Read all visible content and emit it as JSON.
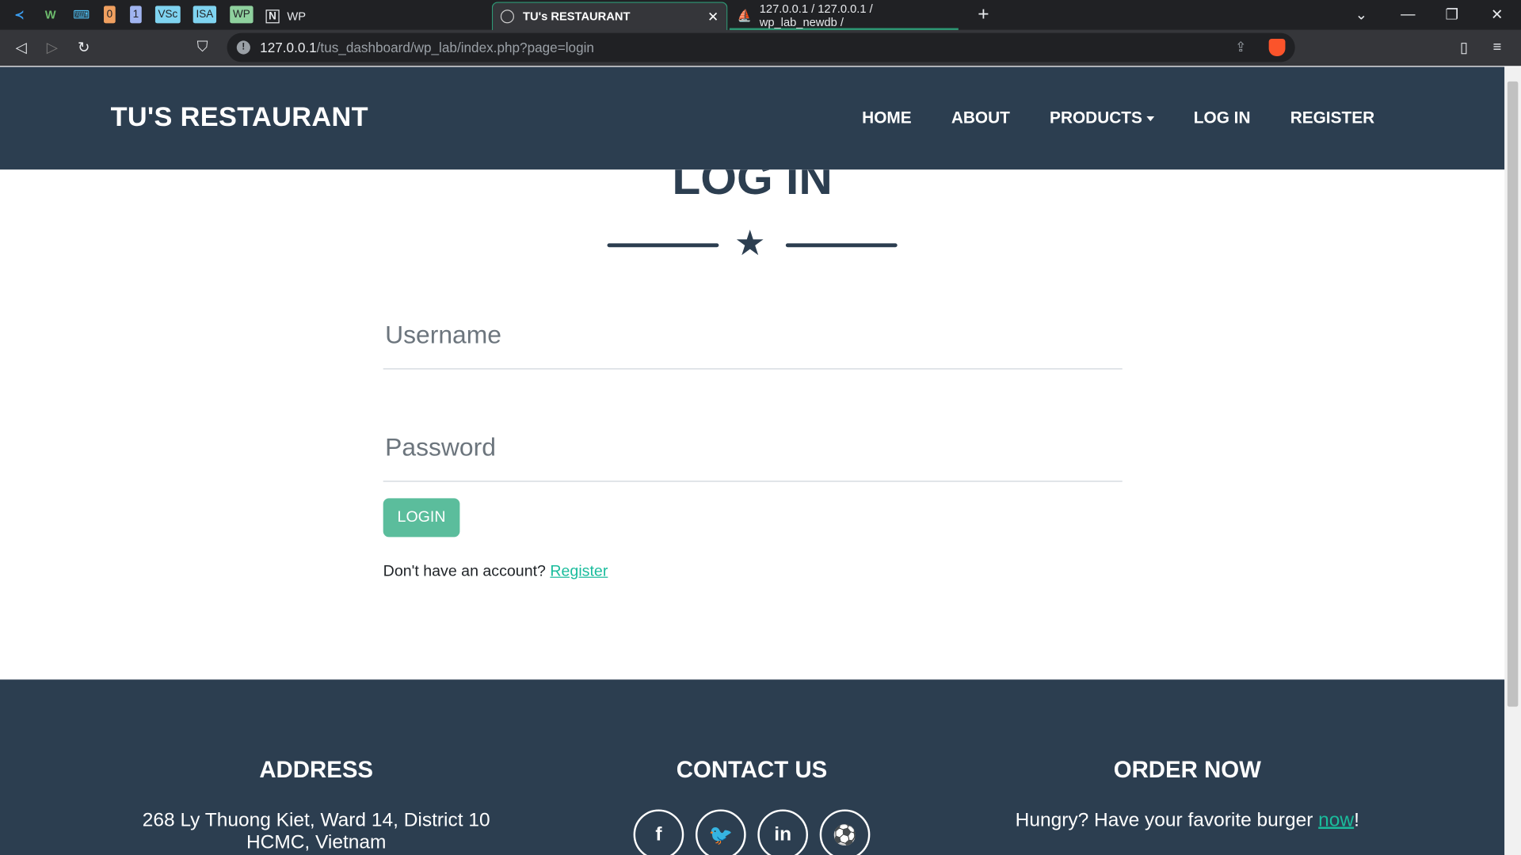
{
  "browser": {
    "pinned_tabs": [
      {
        "label": "VS",
        "icon": "vscode-icon",
        "color": "#3b9df0"
      },
      {
        "label": "W",
        "icon": "w-icon",
        "color": "#6dbb6d"
      },
      {
        "label": "⌨",
        "icon": "keyboard-icon",
        "color": "#4fc3f7"
      },
      {
        "label": "0",
        "icon": "zero-icon",
        "color": "#f0a060"
      },
      {
        "label": "1",
        "icon": "one-icon",
        "color": "#a0b4f0"
      },
      {
        "label": "VSc",
        "icon": "vsc-icon",
        "color": "#7fd3f0"
      },
      {
        "label": "ISA",
        "icon": "isa-icon",
        "color": "#7fd3f0"
      },
      {
        "label": "WP",
        "icon": "wp-icon",
        "color": "#8fd19e"
      }
    ],
    "notion_tab": "WP",
    "active_tab": "TU's RESTAURANT",
    "other_tab": "127.0.0.1 / 127.0.0.1 / wp_lab_newdb /",
    "url_host": "127.0.0.1",
    "url_path": "/tus_dashboard/wp_lab/index.php?page=login"
  },
  "site": {
    "brand": "TU'S RESTAURANT",
    "nav": [
      "HOME",
      "ABOUT",
      "PRODUCTS",
      "LOG IN",
      "REGISTER"
    ]
  },
  "login": {
    "title": "LOG IN",
    "username_placeholder": "Username",
    "password_placeholder": "Password",
    "button": "LOGIN",
    "no_account": "Don't have an account?",
    "register_link": "Register"
  },
  "footer": {
    "address_title": "ADDRESS",
    "address_line1": "268 Ly Thuong Kiet, Ward 14, District 10",
    "address_line2": "HCMC, Vietnam",
    "contact_title": "CONTACT US",
    "socials": [
      {
        "label": "f",
        "icon": "facebook-icon"
      },
      {
        "label": "🐦",
        "icon": "twitter-icon"
      },
      {
        "label": "in",
        "icon": "linkedin-icon"
      },
      {
        "label": "⚽",
        "icon": "dribbble-icon"
      }
    ],
    "order_title": "ORDER NOW",
    "order_text": "Hungry? Have your favorite burger",
    "order_link": "now",
    "order_end": "!"
  }
}
